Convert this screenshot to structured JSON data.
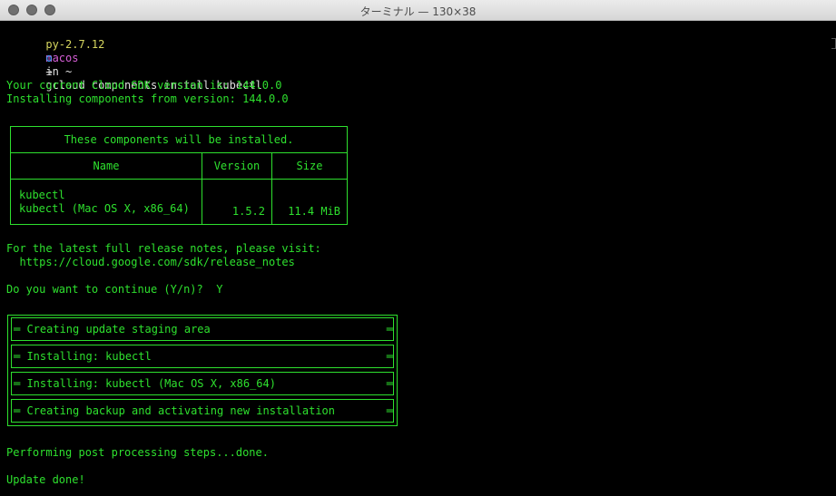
{
  "window": {
    "title": "ターミナル — 130×38"
  },
  "prompt": {
    "env": "py-2.7.12",
    "host": "macos",
    "in_text": "in ~",
    "marker": "o",
    "arrow": "→",
    "command": "gcloud components install kubectl"
  },
  "output": {
    "sdk_version_line": "Your current Cloud SDK version is: 144.0.0",
    "installing_from_line": "Installing components from version: 144.0.0",
    "release_notes_line": "For the latest full release notes, please visit:",
    "release_notes_url": "  https://cloud.google.com/sdk/release_notes",
    "continue_prompt": "Do you want to continue (Y/n)?  Y",
    "post_processing": "Performing post processing steps...done.",
    "update_done": "Update done!"
  },
  "components_table": {
    "caption": "These components will be installed.",
    "headers": [
      "Name",
      "Version",
      "Size"
    ],
    "row": {
      "name_line1": "kubectl",
      "name_line2": "kubectl (Mac OS X, x86_64)",
      "version": "1.5.2",
      "size": "11.4 MiB"
    }
  },
  "progress_steps": [
    {
      "label": "═ Creating update staging area",
      "end": "═"
    },
    {
      "label": "═ Installing: kubectl",
      "end": "═"
    },
    {
      "label": "═ Installing: kubectl (Mac OS X, x86_64)",
      "end": "═"
    },
    {
      "label": "═ Creating backup and activating new installation",
      "end": "═"
    }
  ],
  "colors": {
    "terminal_text": "#2ee02e",
    "env_yellow": "#d7d75f",
    "host_magenta": "#d75fd7",
    "background": "#000000"
  }
}
